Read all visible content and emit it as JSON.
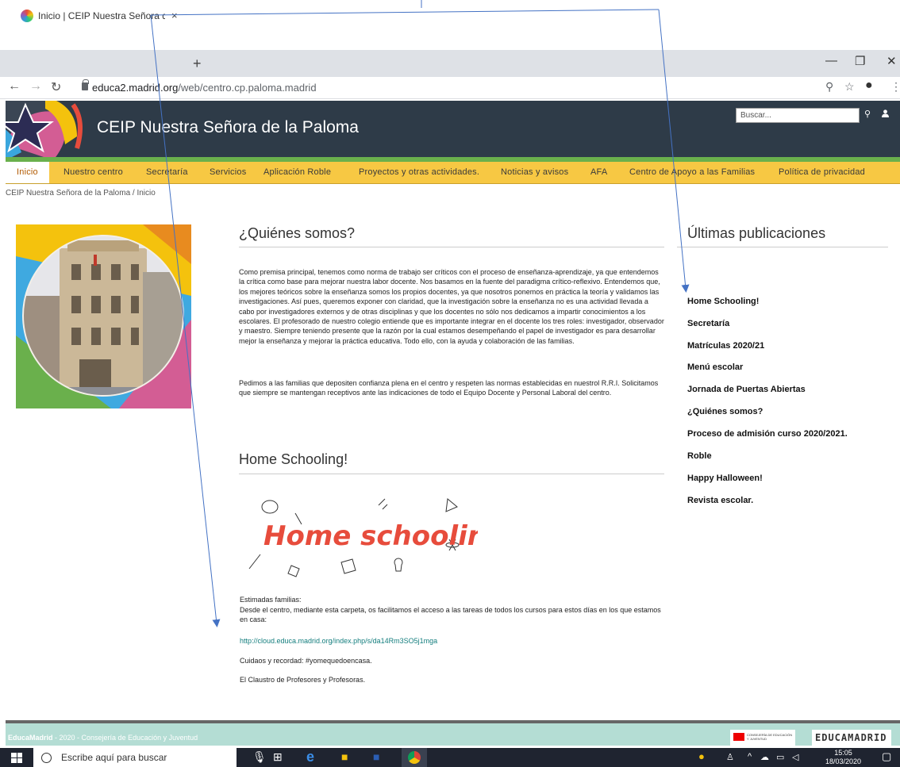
{
  "browser": {
    "tab_title": "Inicio | CEIP Nuestra Señora de la Paloma",
    "tab_close": "×",
    "new_tab": "+",
    "url_host": "educa2.madrid.org",
    "url_path": "/web/centro.cp.paloma.madrid",
    "icons": [
      "back-arrow-icon",
      "forward-arrow-icon",
      "reload-icon",
      "lock-icon",
      "zoom-icon",
      "star-icon",
      "profile-icon",
      "menu-dots-icon"
    ]
  },
  "site": {
    "title": "CEIP Nuestra Señora de la Paloma",
    "search_placeholder": "Buscar..."
  },
  "nav": {
    "items": [
      "Inicio",
      "Nuestro centro",
      "Secretaría",
      "Servicios",
      "Aplicación Roble",
      "Proyectos y otras actividades.",
      "Noticias y avisos",
      "AFA",
      "Centro de Apoyo a las Familias",
      "Política de privacidad"
    ],
    "active": "Inicio"
  },
  "breadcrumb": "CEIP Nuestra Señora de la Paloma / Inicio",
  "main": {
    "quienes_title": "¿Quiénes somos?",
    "quienes_p1": "Como premisa principal, tenemos como norma de trabajo ser críticos con el proceso de enseñanza-aprendizaje, ya que entendemos la crítica como base para mejorar nuestra labor docente. Nos basamos en la fuente del paradigma crítico-reflexivo. Entendemos que, los mejores teóricos sobre la enseñanza somos los propios docentes, ya que nosotros ponemos en práctica la teoría y validamos las investigaciones. Así pues, queremos exponer con claridad, que la investigación sobre la enseñanza no es una actividad llevada a cabo por investigadores externos y de otras disciplinas y que los docentes no sólo nos dedicamos a impartir conocimientos a los escolares. El profesorado de nuestro colegio entiende que es importante integrar en el docente los tres roles: investigador, observador y maestro. Siempre teniendo presente que la razón por la cual estamos desempeñando el papel de investigador es para desarrollar mejor la enseñanza y mejorar la práctica educativa. Todo ello, con la ayuda y colaboración de las familias.",
    "quienes_p2": "Pedimos a las familias que depositen confianza plena en el centro y respeten las normas establecidas en nuestrol R.R.I. Solicitamos que siempre se mantengan receptivos ante las indicaciones de todo el Equipo Docente y Personal Laboral del centro.",
    "home_title": "Home Schooling!",
    "home_img_text": "Home schooling!",
    "home_greeting": "Estimadas familias:",
    "home_body": "Desde el centro, mediante esta carpeta, os facilitamos el acceso a las tareas de todos los cursos para estos días en los que estamos en casa:",
    "home_link": "http://cloud.educa.madrid.org/index.php/s/da14Rm3SO5j1mga",
    "home_care": "Cuidaos y recordad: #yomequedoencasa.",
    "home_sign": "El Claustro de Profesores y Profesoras."
  },
  "sidebar": {
    "title": "Últimas publicaciones",
    "items": [
      "Home Schooling!",
      "Secretaría",
      "Matrículas 2020/21",
      "Menú escolar",
      "Jornada de Puertas Abiertas",
      "¿Quiénes somos?",
      "Proceso de admisión curso 2020/2021.",
      "Roble",
      "Happy Halloween!",
      "Revista escolar."
    ]
  },
  "footer": {
    "brand": "EducaMadrid",
    "rest": " - 2020 - Consejería de Educación y Juventud",
    "comunidad": "CONSEJERÍA DE EDUCACIÓN Y JUVENTUD",
    "educamadrid_logo": "EDUCAMADRID"
  },
  "taskbar": {
    "search": "Escribe aquí para buscar",
    "time": "15:05",
    "date": "18/03/2020"
  }
}
